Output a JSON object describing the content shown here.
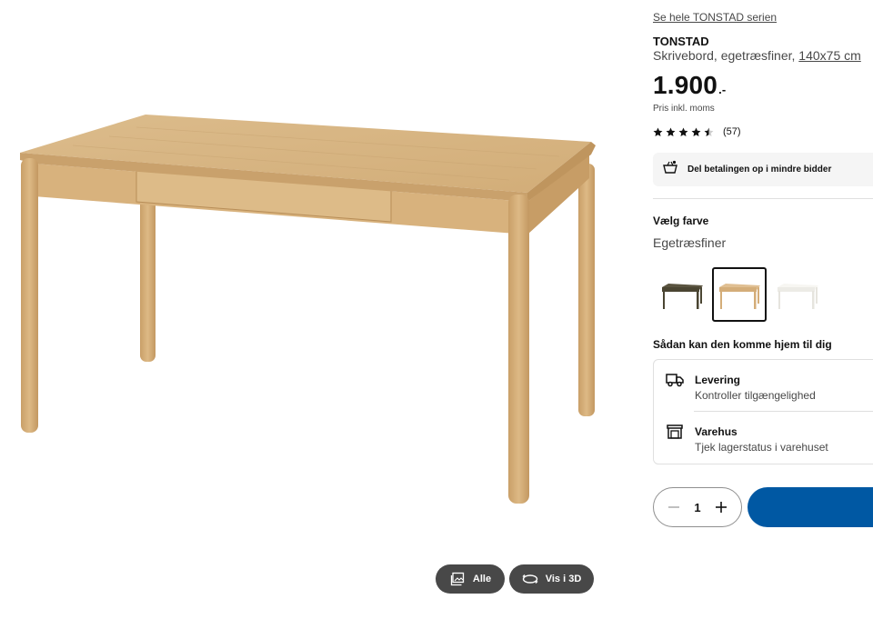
{
  "gallery": {
    "all_label": "Alle",
    "view3d_label": "Vis i 3D"
  },
  "product": {
    "series_link": "Se hele TONSTAD serien",
    "name": "TONSTAD",
    "description": "Skrivebord, egetræsfiner,",
    "dimensions": "140x75 cm",
    "price": "1.900",
    "price_suffix": ".-",
    "price_note": "Pris inkl. moms",
    "rating_value": 4.5,
    "rating_max": 5,
    "review_count": "(57)"
  },
  "payment": {
    "label": "Del betalingen op i mindre bidder"
  },
  "color": {
    "label": "Vælg farve",
    "selected": "Egetræsfiner",
    "swatches": [
      {
        "color": "#4f4a35",
        "selected": false
      },
      {
        "color": "#d9b589",
        "selected": true
      },
      {
        "color": "#f3f1ec",
        "selected": false
      }
    ]
  },
  "delivery": {
    "heading": "Sådan kan den komme hjem til dig",
    "options": [
      {
        "title": "Levering",
        "subtitle": "Kontroller tilgængelighed",
        "icon": "truck-icon"
      },
      {
        "title": "Varehus",
        "subtitle": "Tjek lagerstatus i varehuset",
        "icon": "store-icon"
      }
    ]
  },
  "cart": {
    "quantity": "1",
    "button_color": "#0058a3"
  }
}
